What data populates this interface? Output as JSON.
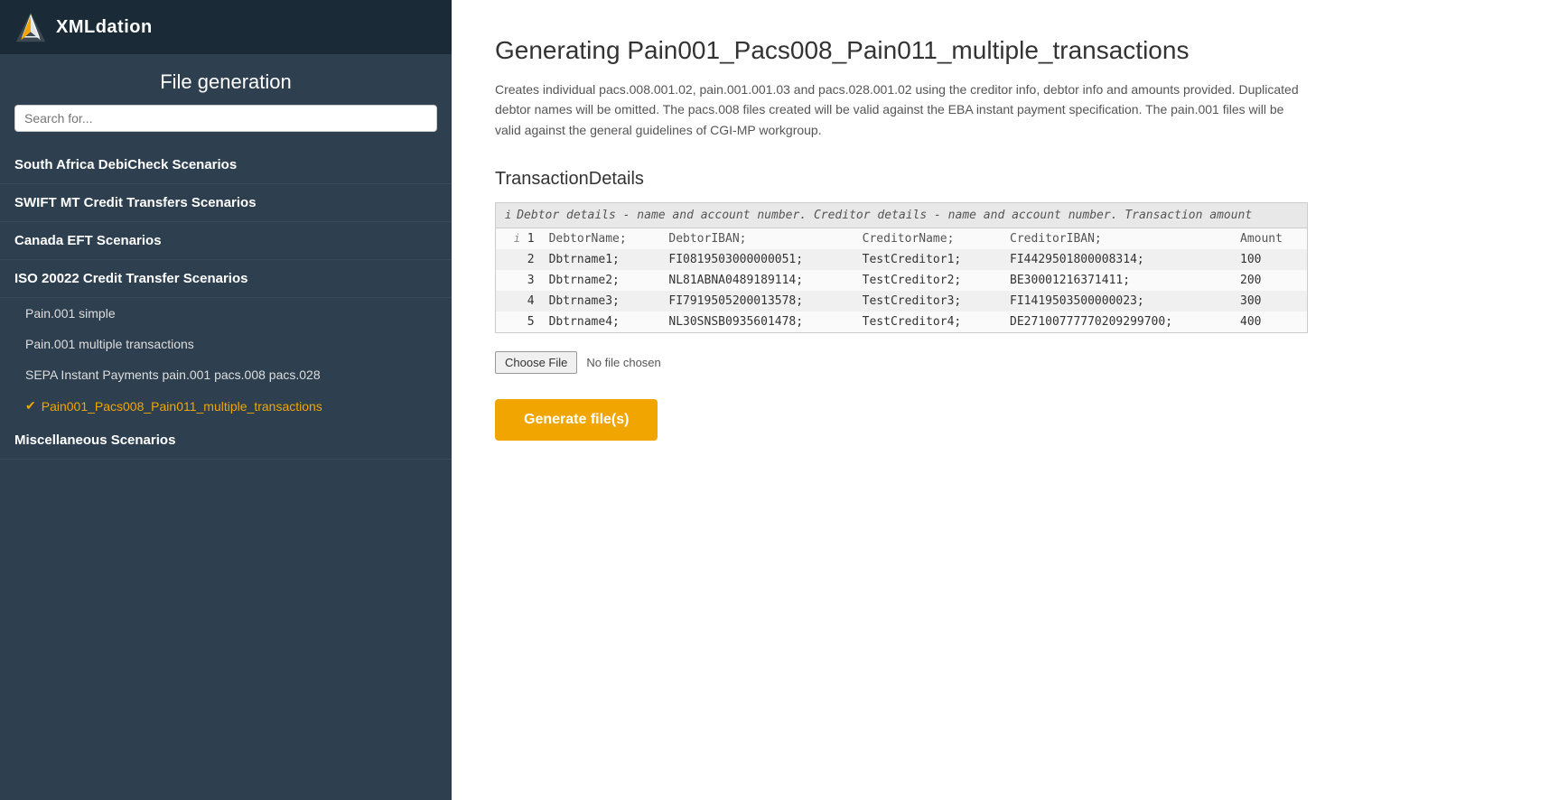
{
  "logo": {
    "text": "XMLdation"
  },
  "sidebar": {
    "title": "File generation",
    "search_placeholder": "Search for...",
    "nav_items": [
      {
        "id": "south-africa",
        "label": "South Africa DebiCheck Scenarios",
        "sub_items": []
      },
      {
        "id": "swift-mt",
        "label": "SWIFT MT Credit Transfers Scenarios",
        "sub_items": []
      },
      {
        "id": "canada-eft",
        "label": "Canada EFT Scenarios",
        "sub_items": []
      },
      {
        "id": "iso-20022",
        "label": "ISO 20022 Credit Transfer Scenarios",
        "sub_items": [
          {
            "id": "pain001-simple",
            "label": "Pain.001 simple",
            "active": false
          },
          {
            "id": "pain001-multiple",
            "label": "Pain.001 multiple transactions",
            "active": false
          },
          {
            "id": "sepa-instant",
            "label": "SEPA Instant Payments pain.001 pacs.008 pacs.028",
            "active": false
          },
          {
            "id": "pain001-pacs008",
            "label": "Pain001_Pacs008_Pain011_multiple_transactions",
            "active": true
          }
        ]
      },
      {
        "id": "miscellaneous",
        "label": "Miscellaneous Scenarios",
        "sub_items": []
      }
    ]
  },
  "main": {
    "title": "Generating Pain001_Pacs008_Pain011_multiple_transactions",
    "description": "Creates individual pacs.008.001.02, pain.001.001.03 and pacs.028.001.02 using the creditor info, debtor info and amounts provided. Duplicated debtor names will be omitted. The pacs.008 files created will be valid against the EBA instant payment specification. The pain.001 files will be valid against the general guidelines of CGI-MP workgroup.",
    "section_title": "TransactionDetails",
    "table": {
      "header_note": "Debtor details - name and account number. Creditor details - name and account number. Transaction amount",
      "columns": [
        "DebtorName;",
        "DebtorIBAN;",
        "CreditorName;",
        "CreditorIBAN;",
        "Amount"
      ],
      "rows": [
        {
          "num": "1",
          "info": true,
          "cells": [
            "DebtorName;",
            "DebtorIBAN;",
            "CreditorName;",
            "CreditorIBAN;",
            "Amount"
          ]
        },
        {
          "num": "2",
          "info": false,
          "cells": [
            "Dbtrname1;",
            "FI0819503000000051;",
            "TestCreditor1;",
            "FI44295018000083​14;",
            "100"
          ]
        },
        {
          "num": "3",
          "info": false,
          "cells": [
            "Dbtrname2;",
            "NL81ABNA0489189114;",
            "TestCreditor2;",
            "BE30001216371411;",
            "200"
          ]
        },
        {
          "num": "4",
          "info": false,
          "cells": [
            "Dbtrname3;",
            "FI7919505200013578;",
            "TestCreditor3;",
            "FI14195035000000​23;",
            "300"
          ]
        },
        {
          "num": "5",
          "info": false,
          "cells": [
            "Dbtrname4;",
            "NL30SNSB0935601478;",
            "TestCreditor4;",
            "DE27100777770209​299700;",
            "400"
          ]
        }
      ]
    },
    "file_input": {
      "choose_label": "Choose File",
      "no_file_text": "No file chosen"
    },
    "generate_button": "Generate file(s)"
  }
}
